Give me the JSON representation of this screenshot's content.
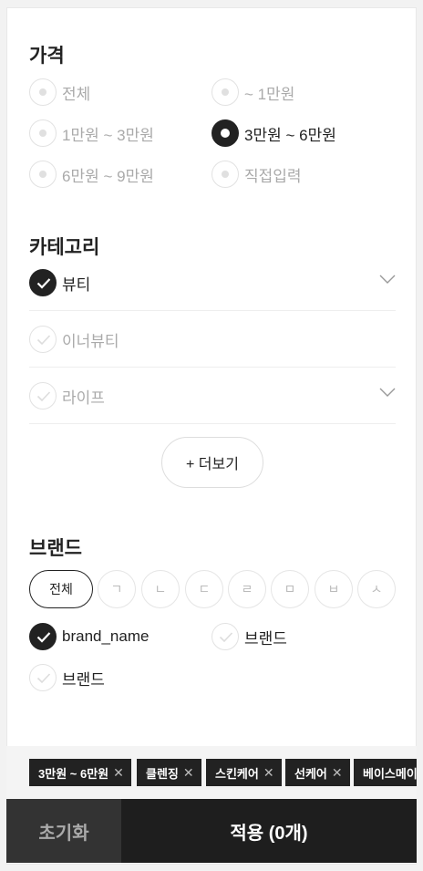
{
  "price": {
    "title": "가격",
    "options": [
      {
        "label": "전체",
        "selected": false
      },
      {
        "label": "~ 1만원",
        "selected": false
      },
      {
        "label": "1만원 ~ 3만원",
        "selected": false
      },
      {
        "label": "3만원 ~ 6만원",
        "selected": true
      },
      {
        "label": "6만원 ~ 9만원",
        "selected": false
      },
      {
        "label": "직접입력",
        "selected": false
      }
    ]
  },
  "category": {
    "title": "카테고리",
    "items": [
      {
        "label": "뷰티",
        "checked": true,
        "expandable": true
      },
      {
        "label": "이너뷰티",
        "checked": false,
        "expandable": false
      },
      {
        "label": "라이프",
        "checked": false,
        "expandable": true
      }
    ],
    "more_label": "+ 더보기"
  },
  "brand": {
    "title": "브랜드",
    "tabs": [
      "전체",
      "ㄱ",
      "ㄴ",
      "ㄷ",
      "ㄹ",
      "ㅁ",
      "ㅂ",
      "ㅅ"
    ],
    "items": [
      {
        "label": "brand_name",
        "checked": true
      },
      {
        "label": "브랜드",
        "checked": false
      },
      {
        "label": "브랜드",
        "checked": false
      }
    ]
  },
  "selected_chips": [
    "3만원 ~ 6만원",
    "클렌징",
    "스킨케어",
    "선케어",
    "베이스메이크업"
  ],
  "actions": {
    "reset_label": "초기화",
    "apply_label": "적용 (0개)"
  }
}
